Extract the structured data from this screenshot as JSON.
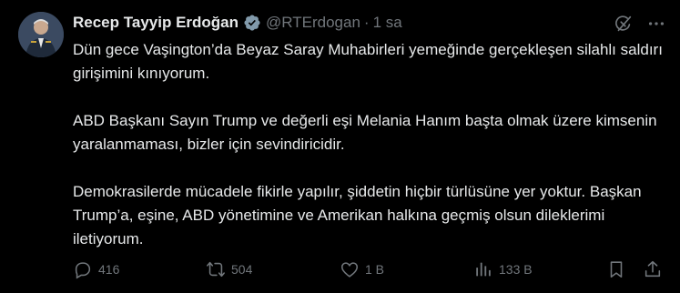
{
  "author": {
    "display_name": "Recep Tayyip Erdoğan",
    "handle": "@RTErdogan",
    "separator": "·",
    "time": "1 sa",
    "verified_color": "#829aab"
  },
  "top_icons": [
    "grok-icon",
    "more-icon"
  ],
  "tweet": {
    "paragraphs": [
      "Dün gece Vaşington’da Beyaz Saray Muhabirleri yemeğinde gerçekleşen silahlı saldırı girişimini kınıyorum.",
      "ABD Başkanı Sayın Trump ve değerli eşi Melania Hanım başta olmak üzere kimsenin yaralanmaması, bizler için sevindiricidir.",
      "Demokrasilerde mücadele fikirle yapılır, şiddetin hiçbir türlüsüne yer yoktur. Başkan Trump’a, eşine, ABD yönetimine ve Amerikan halkına geçmiş olsun dileklerimi iletiyorum."
    ]
  },
  "actions": {
    "replies": "416",
    "reposts": "504",
    "likes": "1 B",
    "views": "133 B"
  },
  "colors": {
    "background": "#000000",
    "text": "#e7e9ea",
    "muted": "#71767b"
  }
}
